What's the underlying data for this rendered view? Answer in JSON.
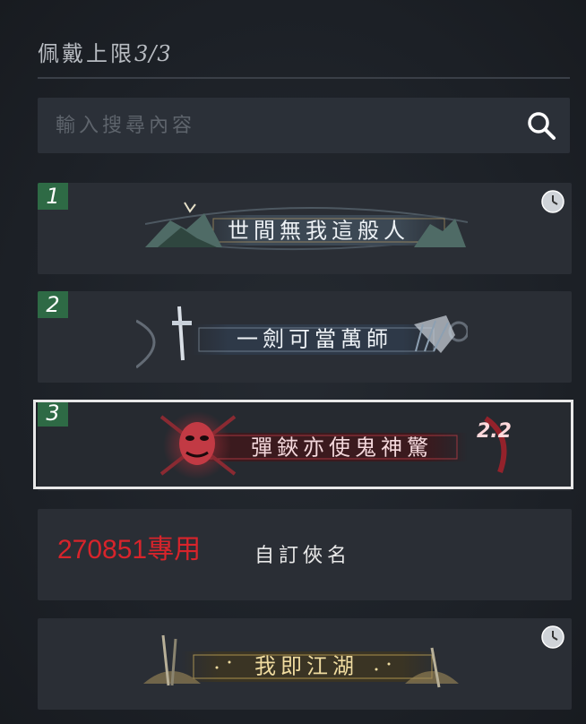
{
  "header": {
    "label": "佩戴上限",
    "count": "3/3"
  },
  "search": {
    "placeholder": "輸入搜尋內容"
  },
  "titles": [
    {
      "number": "1",
      "text": "世間無我這般人",
      "has_clock": true
    },
    {
      "number": "2",
      "text": "一劍可當萬師",
      "has_clock": false
    },
    {
      "number": "3",
      "text": "彈鋏亦使鬼神驚",
      "badge": "2.2",
      "selected": true
    },
    {
      "custom_name": "270851專用",
      "custom_label": "自訂俠名"
    },
    {
      "text": "我即江湖",
      "has_clock": true
    }
  ],
  "colors": {
    "badge_green": "#2e6a45",
    "custom_red": "#d8242b",
    "gold_text": "#f0dca0",
    "silver_text": "#eef2f6"
  }
}
